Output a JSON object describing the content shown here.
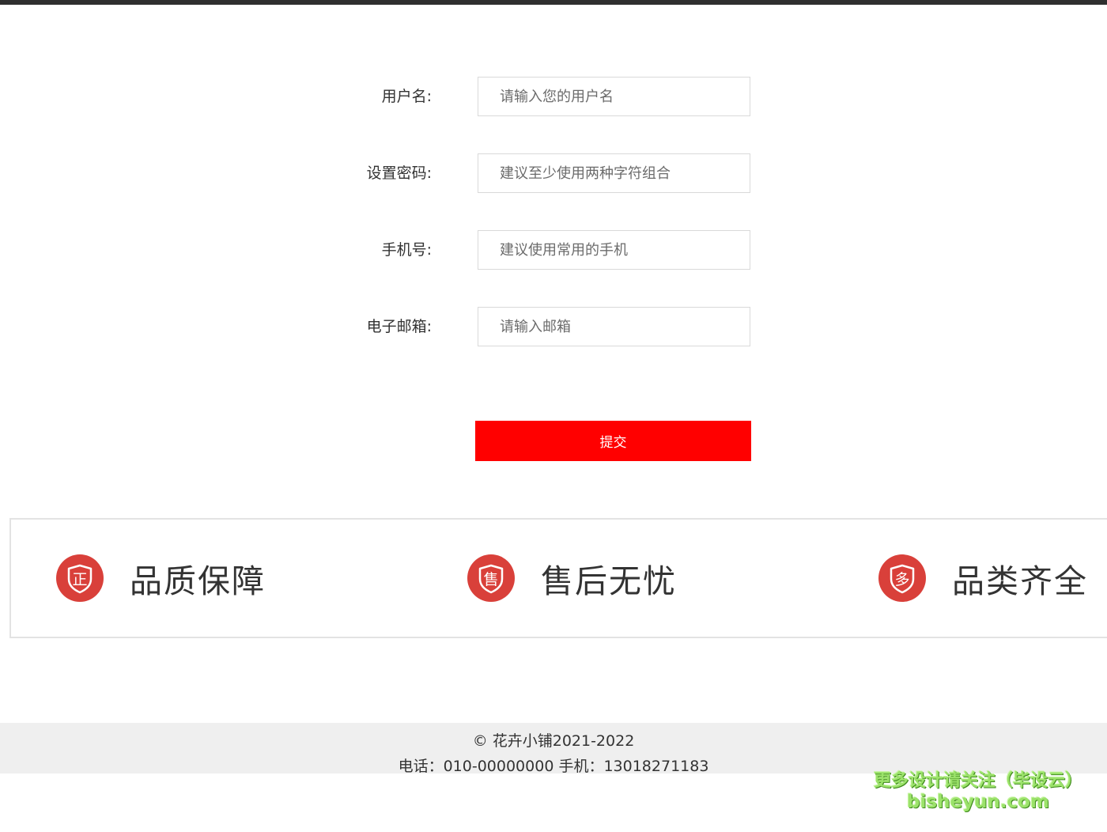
{
  "form": {
    "fields": [
      {
        "label": "用户名:",
        "placeholder": "请输入您的用户名",
        "value": ""
      },
      {
        "label": "设置密码:",
        "placeholder": "建议至少使用两种字符组合",
        "value": ""
      },
      {
        "label": "手机号:",
        "placeholder": "建议使用常用的手机",
        "value": ""
      },
      {
        "label": "电子邮箱:",
        "placeholder": "请输入邮箱",
        "value": ""
      }
    ],
    "submit_label": "提交"
  },
  "features": [
    {
      "icon": "zheng-badge-icon",
      "glyph": "正",
      "label": "品质保障"
    },
    {
      "icon": "shou-badge-icon",
      "glyph": "售",
      "label": "售后无忧"
    },
    {
      "icon": "duo-badge-icon",
      "glyph": "多",
      "label": "品类齐全"
    }
  ],
  "footer": {
    "copyright": "© 花卉小铺2021-2022",
    "contact": "电话：010-00000000 手机：13018271183"
  },
  "watermark": {
    "line1": "更多设计请关注（毕设云）",
    "line2": "bisheyun.com"
  },
  "colors": {
    "accent": "#ff0000",
    "badge": "#d9403a",
    "footer_bg": "#efefef"
  }
}
